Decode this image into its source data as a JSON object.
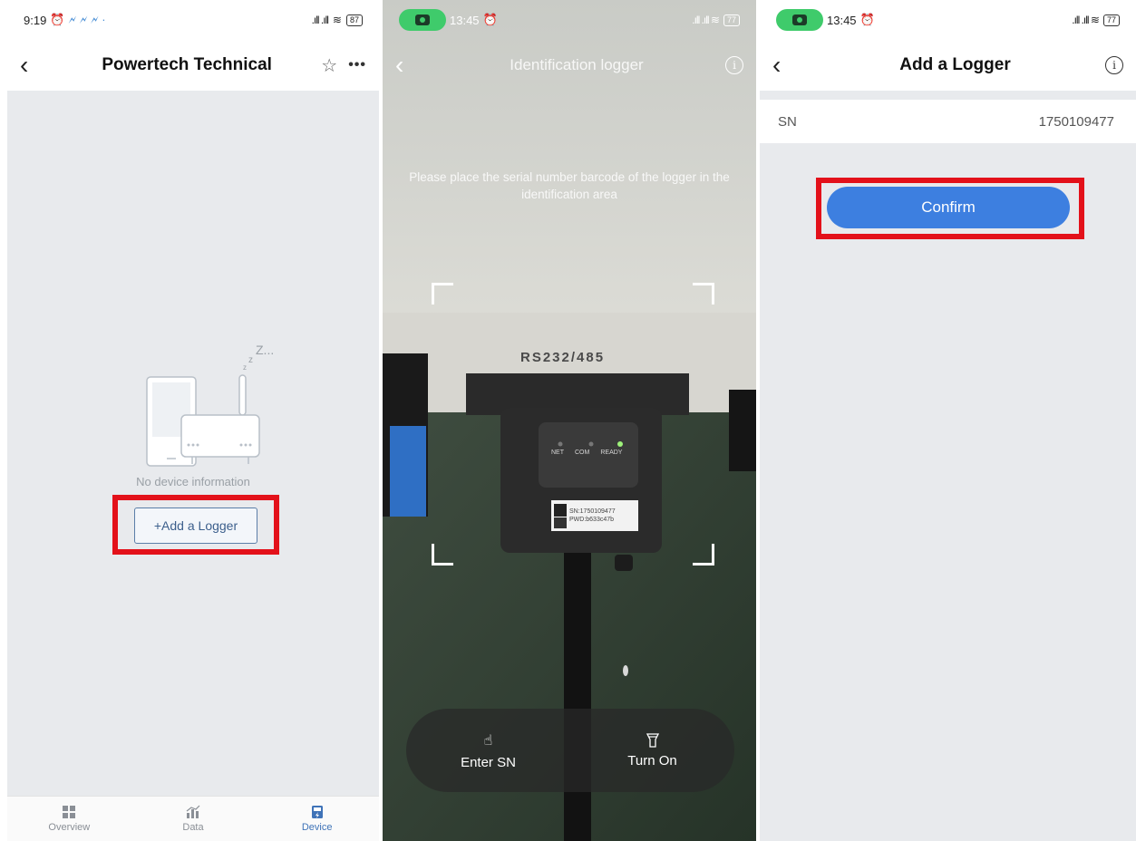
{
  "screen1": {
    "status": {
      "time": "9:19",
      "signal": ".ıll .ıll",
      "battery": "87"
    },
    "nav": {
      "back": "‹",
      "title": "Powertech Technical",
      "star": "☆",
      "more": "•••"
    },
    "empty": {
      "zzz": "Z...",
      "text": "No device information"
    },
    "add_button": "+Add a Logger",
    "tabs": [
      {
        "label": "Overview",
        "icon": "grid-icon"
      },
      {
        "label": "Data",
        "icon": "chart-icon"
      },
      {
        "label": "Device",
        "icon": "device-icon"
      }
    ],
    "active_tab": "Device"
  },
  "screen2": {
    "status": {
      "time": "13:45",
      "battery": "77"
    },
    "nav": {
      "back": "‹",
      "title": "Identification logger"
    },
    "hint": "Please place the serial number barcode of the logger in the identification area",
    "device": {
      "port_label": "RS232/485",
      "leds": [
        "NET",
        "COM",
        "READY"
      ],
      "sn_label": "SN:1750109477",
      "pwd_label": "PWD:b633c47b"
    },
    "actions": [
      {
        "label": "Enter SN",
        "icon": "hand-tap-icon"
      },
      {
        "label": "Turn On",
        "icon": "flashlight-icon"
      }
    ]
  },
  "screen3": {
    "status": {
      "time": "13:45",
      "battery": "77"
    },
    "nav": {
      "back": "‹",
      "title": "Add a Logger"
    },
    "sn": {
      "label": "SN",
      "value": "1750109477"
    },
    "confirm": "Confirm"
  },
  "colors": {
    "highlight": "#e3111a",
    "accent_blue": "#3d7fe0",
    "background_gray": "#e8eaed"
  }
}
